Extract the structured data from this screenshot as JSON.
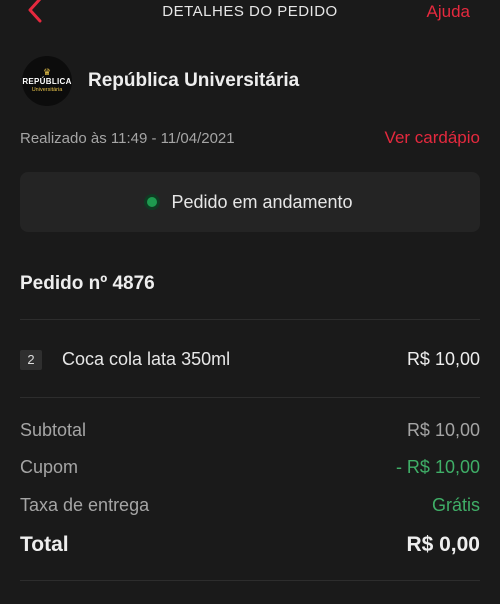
{
  "header": {
    "title": "DETALHES DO PEDIDO",
    "help": "Ajuda"
  },
  "store": {
    "name": "República Universitária",
    "logo": {
      "line1": "REPÚBLICA",
      "line2": "Universitária"
    }
  },
  "order_meta": {
    "placed": "Realizado às 11:49 - 11/04/2021",
    "menu_link": "Ver cardápio"
  },
  "status": {
    "text": "Pedido em andamento",
    "color": "#1e9a4f"
  },
  "order": {
    "title": "Pedido nº 4876",
    "items": [
      {
        "qty": "2",
        "name": "Coca cola lata 350ml",
        "price": "R$ 10,00"
      }
    ]
  },
  "summary": {
    "subtotal_label": "Subtotal",
    "subtotal_value": "R$ 10,00",
    "coupon_label": "Cupom",
    "coupon_value": "- R$ 10,00",
    "delivery_label": "Taxa de entrega",
    "delivery_value": "Grátis",
    "total_label": "Total",
    "total_value": "R$ 0,00"
  },
  "colors": {
    "accent": "#e5293e",
    "positive": "#3fae67",
    "background": "#1a1a1a"
  },
  "icons": {
    "back": "chevron-left-icon",
    "status": "dot-icon"
  }
}
